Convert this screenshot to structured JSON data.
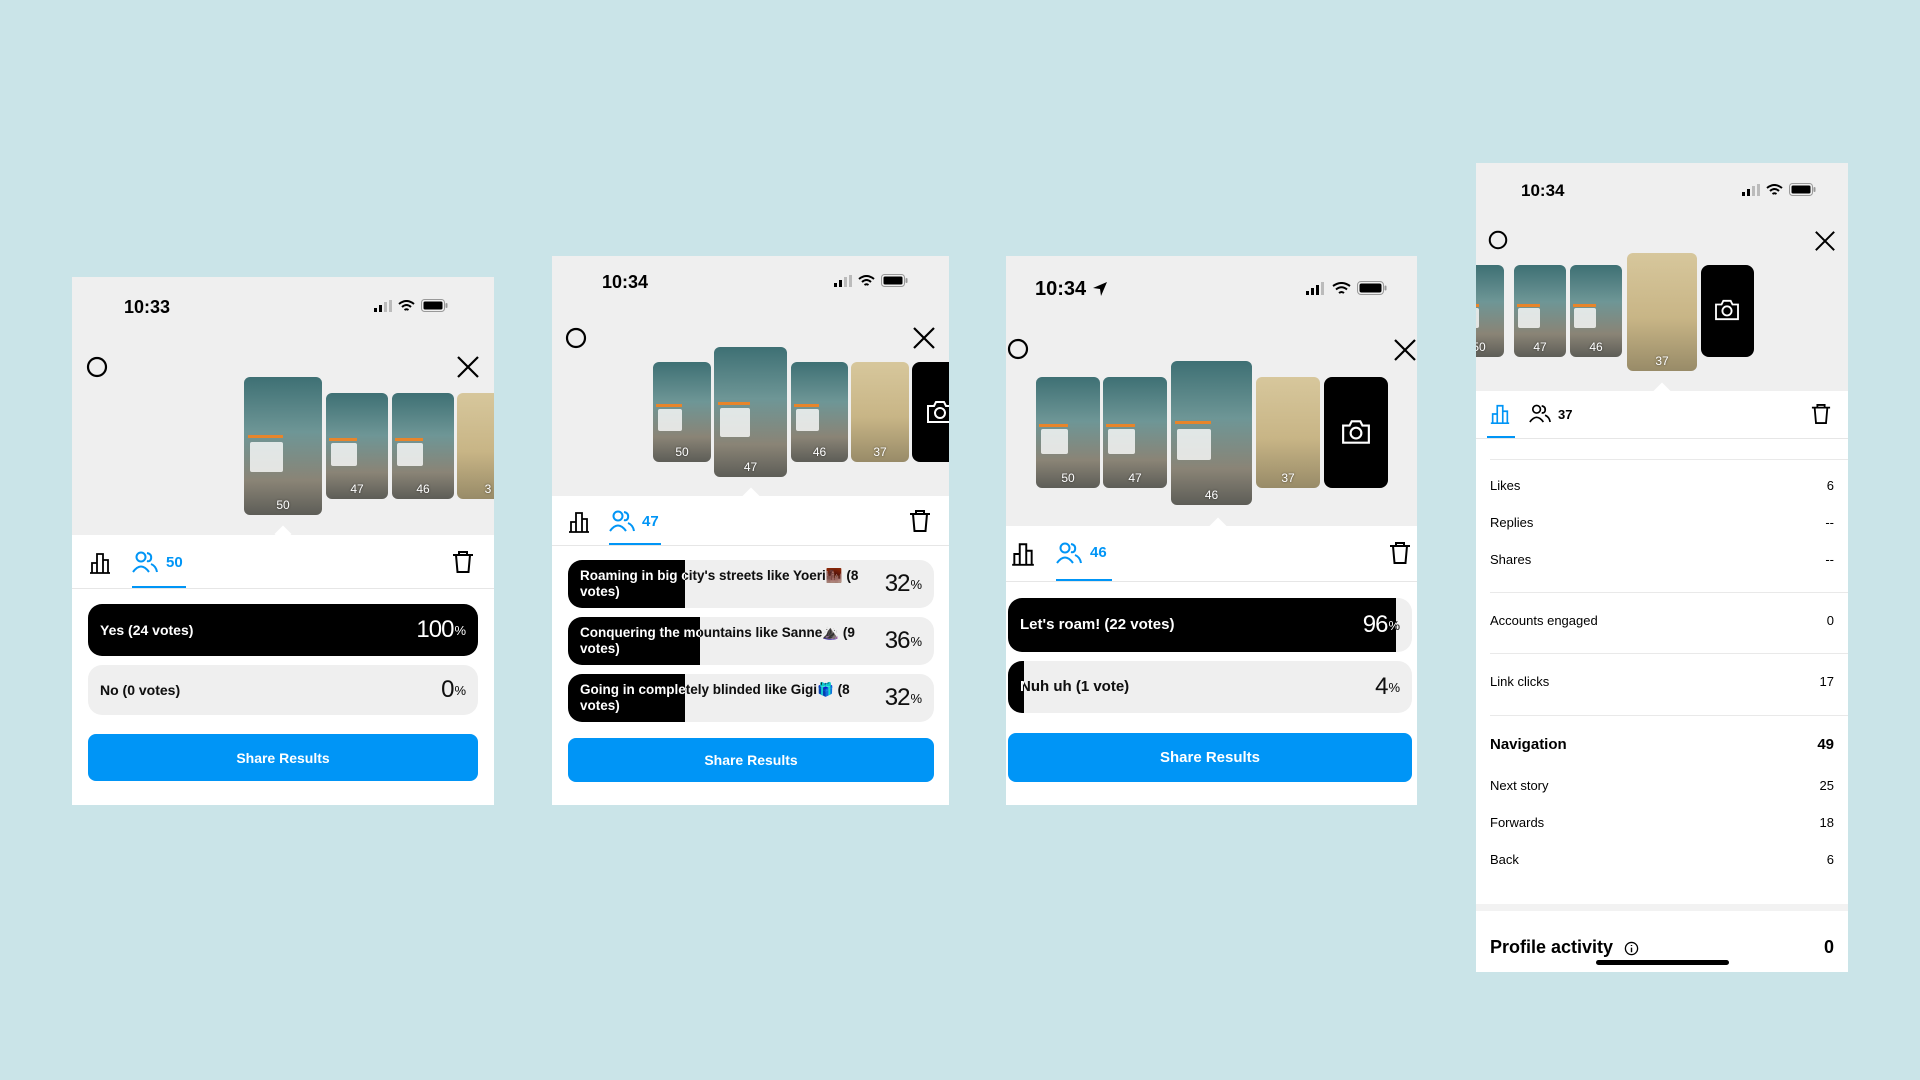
{
  "colors": {
    "background": "#cae4e8",
    "accent": "#0095f6",
    "fill": "#000000"
  },
  "icons": {
    "settings": "settings-icon",
    "close": "close-icon",
    "insights": "bar-chart-icon",
    "viewers": "people-icon",
    "delete": "trash-icon",
    "camera": "camera-icon",
    "signal": "signal-icon",
    "wifi": "wifi-icon",
    "battery": "battery-icon",
    "location": "location-arrow-icon",
    "info": "info-icon"
  },
  "screens": [
    {
      "time": "10:33",
      "thumbnails": [
        {
          "count": "50"
        },
        {
          "count": "47"
        },
        {
          "count": "46"
        },
        {
          "count": "3"
        }
      ],
      "viewer_count": "50",
      "options": [
        {
          "label": "Yes (24 votes)",
          "percent": 100,
          "pct_text": "100"
        },
        {
          "label": "No (0 votes)",
          "percent": 0,
          "pct_text": "0"
        }
      ],
      "share_label": "Share Results"
    },
    {
      "time": "10:34",
      "thumbnails": [
        {
          "count": "50"
        },
        {
          "count": "47"
        },
        {
          "count": "46"
        },
        {
          "count": "37"
        }
      ],
      "viewer_count": "47",
      "options": [
        {
          "label": "Roaming in big city's streets like Yoeri🏙️ (8 votes)",
          "percent": 32,
          "pct_text": "32"
        },
        {
          "label": "Conquering the mountains like Sanne⛰️ (9 votes)",
          "percent": 36,
          "pct_text": "36"
        },
        {
          "label": "Going in completely blinded like Gigi🎁 (8 votes)",
          "percent": 32,
          "pct_text": "32"
        }
      ],
      "share_label": "Share Results"
    },
    {
      "time": "10:34",
      "thumbnails": [
        {
          "count": "50"
        },
        {
          "count": "47"
        },
        {
          "count": "46"
        },
        {
          "count": "37"
        }
      ],
      "viewer_count": "46",
      "options": [
        {
          "label": "Let's roam! (22 votes)",
          "percent": 96,
          "pct_text": "96"
        },
        {
          "label": "Nuh uh (1 vote)",
          "percent": 4,
          "pct_text": "4"
        }
      ],
      "share_label": "Share Results"
    },
    {
      "time": "10:34",
      "thumbnails": [
        {
          "count": "50"
        },
        {
          "count": "47"
        },
        {
          "count": "46"
        },
        {
          "count": "37"
        }
      ],
      "viewer_count": "37",
      "insights": {
        "likes_label": "Likes",
        "likes": "6",
        "replies_label": "Replies",
        "replies": "--",
        "shares_label": "Shares",
        "shares": "--",
        "accounts_label": "Accounts engaged",
        "accounts": "0",
        "links_label": "Link clicks",
        "links": "17",
        "nav_label": "Navigation",
        "nav": "49",
        "next_label": "Next story",
        "next": "25",
        "fwd_label": "Forwards",
        "fwd": "18",
        "back_label": "Back",
        "back": "6",
        "profile_label": "Profile activity",
        "profile": "0"
      }
    }
  ],
  "pct_symbol": "%"
}
